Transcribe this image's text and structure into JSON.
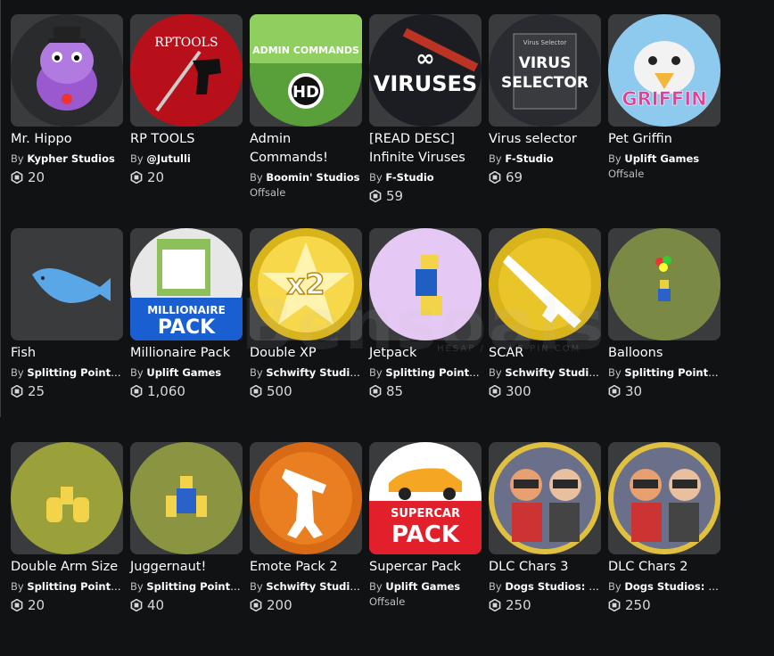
{
  "items": [
    {
      "title": "Mr. Hippo",
      "by": "By",
      "creator": "Kypher Studios",
      "price": "20",
      "icon": "hippo-icon",
      "bg": "#2a2b2d",
      "accent": "#9b59d0"
    },
    {
      "title": "RP TOOLS",
      "by": "By",
      "creator": "@Jutulli",
      "price": "20",
      "icon": "rp-tools-icon",
      "bg": "#b8101a",
      "accent": "#111111",
      "art_text": "RPTOOLS"
    },
    {
      "title": "Admin Commands!",
      "by": "By",
      "creator": "Boomin' Studios",
      "price": "",
      "offsale": "Offsale",
      "icon": "admin-commands-icon",
      "bg": "#5aa03a",
      "accent": "#ffffff",
      "art_text": "ADMIN COMMANDS",
      "art_text2": "HD"
    },
    {
      "title": "[READ DESC] Infinite Viruses",
      "by": "By",
      "creator": "F-Studio",
      "price": "59",
      "icon": "infinite-viruses-icon",
      "bg": "#1c1d22",
      "accent": "#ffffff",
      "art_text": "VIRUSES",
      "art_text2": "∞"
    },
    {
      "title": "Virus selector",
      "by": "By",
      "creator": "F-Studio",
      "price": "69",
      "icon": "virus-selector-icon",
      "bg": "#2a2b30",
      "accent": "#ffffff",
      "art_text": "VIRUS SELECTOR",
      "art_text2": "Virus Selector"
    },
    {
      "title": "Pet Griffin",
      "by": "By",
      "creator": "Uplift Games",
      "price": "",
      "offsale": "Offsale",
      "icon": "griffin-icon",
      "bg": "#8ec9ee",
      "accent": "#e23f9a",
      "art_text": "GRIFFIN"
    },
    {
      "title": "Fish",
      "by": "By",
      "creator": "Splitting Point Studios",
      "price": "25",
      "icon": "fish-icon",
      "bg": "#393b3d",
      "accent": "#5aa7e8"
    },
    {
      "title": "Millionaire Pack",
      "by": "By",
      "creator": "Uplift Games",
      "price": "1,060",
      "icon": "millionaire-pack-icon",
      "bg": "#e7e7e7",
      "accent": "#1a5fd1",
      "art_text": "MILLIONAIRE",
      "art_text2": "PACK"
    },
    {
      "title": "Double XP",
      "by": "By",
      "creator": "Schwifty Studios",
      "price": "500",
      "icon": "double-xp-icon",
      "bg": "#d8b31a",
      "accent": "#f7d84a",
      "art_text": "x2"
    },
    {
      "title": "Jetpack",
      "by": "By",
      "creator": "Splitting Point Studios",
      "price": "85",
      "icon": "jetpack-icon",
      "bg": "#e6c8f4",
      "accent": "#f2d34a"
    },
    {
      "title": "SCAR",
      "by": "By",
      "creator": "Schwifty Studios",
      "price": "300",
      "icon": "scar-icon",
      "bg": "#d8b31a",
      "accent": "#ffffff"
    },
    {
      "title": "Balloons",
      "by": "By",
      "creator": "Splitting Point Studios",
      "price": "30",
      "icon": "balloons-icon",
      "bg": "#7a8a45",
      "accent": "#e8d040"
    },
    {
      "title": "Double Arm Size",
      "by": "By",
      "creator": "Splitting Point Studios",
      "price": "20",
      "icon": "double-arm-size-icon",
      "bg": "#9aa03a",
      "accent": "#f2d34a"
    },
    {
      "title": "Juggernaut!",
      "by": "By",
      "creator": "Splitting Point Studios",
      "price": "40",
      "icon": "juggernaut-icon",
      "bg": "#8b9440",
      "accent": "#2a62c9"
    },
    {
      "title": "Emote Pack 2",
      "by": "By",
      "creator": "Schwifty Studios",
      "price": "200",
      "icon": "emote-pack-icon",
      "bg": "#d86a15",
      "accent": "#ffffff"
    },
    {
      "title": "Supercar Pack",
      "by": "By",
      "creator": "Uplift Games",
      "price": "",
      "offsale": "Offsale",
      "icon": "supercar-pack-icon",
      "bg": "#ffffff",
      "accent": "#e2202c",
      "art_text": "SUPERCAR",
      "art_text2": "PACK"
    },
    {
      "title": "DLC Chars 3",
      "by": "By",
      "creator": "Dogs Studios: Souls",
      "price": "250",
      "icon": "dlc-chars-3-icon",
      "bg": "#e0c040",
      "accent": "#2a2a2a"
    },
    {
      "title": "DLC Chars 2",
      "by": "By",
      "creator": "Dogs Studios: Souls",
      "price": "250",
      "icon": "dlc-chars-2-icon",
      "bg": "#e0c040",
      "accent": "#2a2a2a"
    }
  ],
  "watermark": "Bensoals",
  "watermark_sub": "HESAP / ... / E-PIN.COM",
  "colors": {
    "robux": "#d7d8d9",
    "tile": "#393b3d",
    "page": "#111214"
  }
}
